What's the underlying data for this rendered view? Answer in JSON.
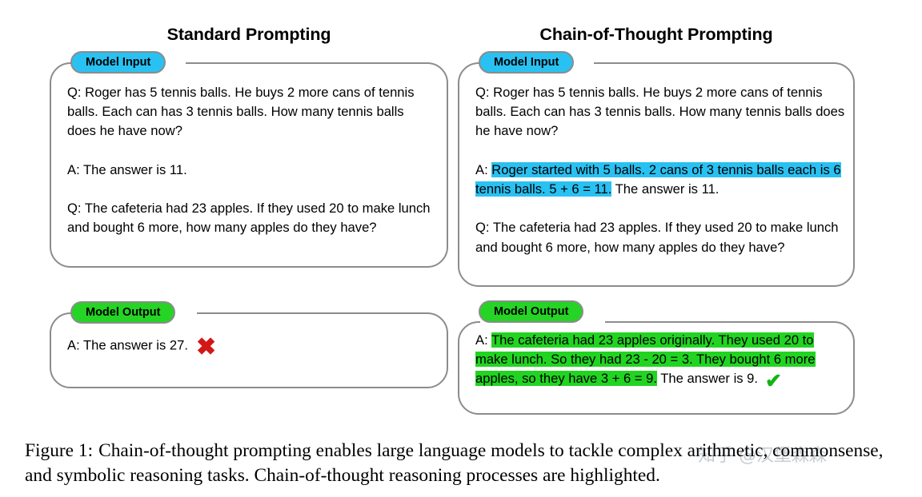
{
  "figure": {
    "columns": [
      {
        "title": "Standard Prompting"
      },
      {
        "title": "Chain-of-Thought Prompting"
      }
    ],
    "badges": {
      "input_label": "Model Input",
      "output_label": "Model Output",
      "input_color": "#29c1f2",
      "output_color": "#25d425"
    },
    "standard": {
      "input": {
        "question_1": "Q: Roger has 5 tennis balls. He buys 2 more cans of tennis balls. Each can has 3 tennis balls. How many tennis balls does he have now?",
        "answer_1": "A: The answer is 11.",
        "question_2": "Q: The cafeteria had 23 apples. If they used 20 to make lunch and bought 6 more, how many apples do they have?"
      },
      "output": {
        "answer_prefix": "A: The answer is 27.",
        "result_mark": "cross-mark-icon",
        "result_glyph": "✖",
        "result_color": "#d31717"
      }
    },
    "chain_of_thought": {
      "input": {
        "question_1": "Q: Roger has 5 tennis balls. He buys 2 more cans of tennis balls. Each can has 3 tennis balls. How many tennis balls does he have now?",
        "answer_2_prefix": "A: ",
        "answer_2_highlight": "Roger started with 5 balls. 2 cans of 3 tennis balls each is 6 tennis balls. 5 + 6 = 11.",
        "answer_2_suffix": " The answer is 11.",
        "question_2": "Q: The cafeteria had 23 apples. If they used 20 to make lunch and bought 6 more, how many apples do they have?",
        "highlight_color": "#29c1f2"
      },
      "output": {
        "answer_prefix": "A: ",
        "answer_highlight": "The cafeteria had 23 apples originally. They used 20 to make lunch. So they had 23 - 20 = 3. They bought 6 more apples, so they have 3 + 6 = 9.",
        "answer_suffix": " The answer is 9.",
        "highlight_color": "#22d422",
        "result_mark": "check-mark-icon",
        "result_glyph": "✔",
        "result_color": "#12b512"
      }
    },
    "caption": {
      "label": "Figure 1:",
      "text": "Chain-of-thought prompting enables large language models to tackle complex arithmetic, commonsense, and symbolic reasoning tasks. Chain-of-thought reasoning processes are highlighted."
    },
    "watermark": {
      "text": "知乎 @汉堡森森"
    }
  }
}
